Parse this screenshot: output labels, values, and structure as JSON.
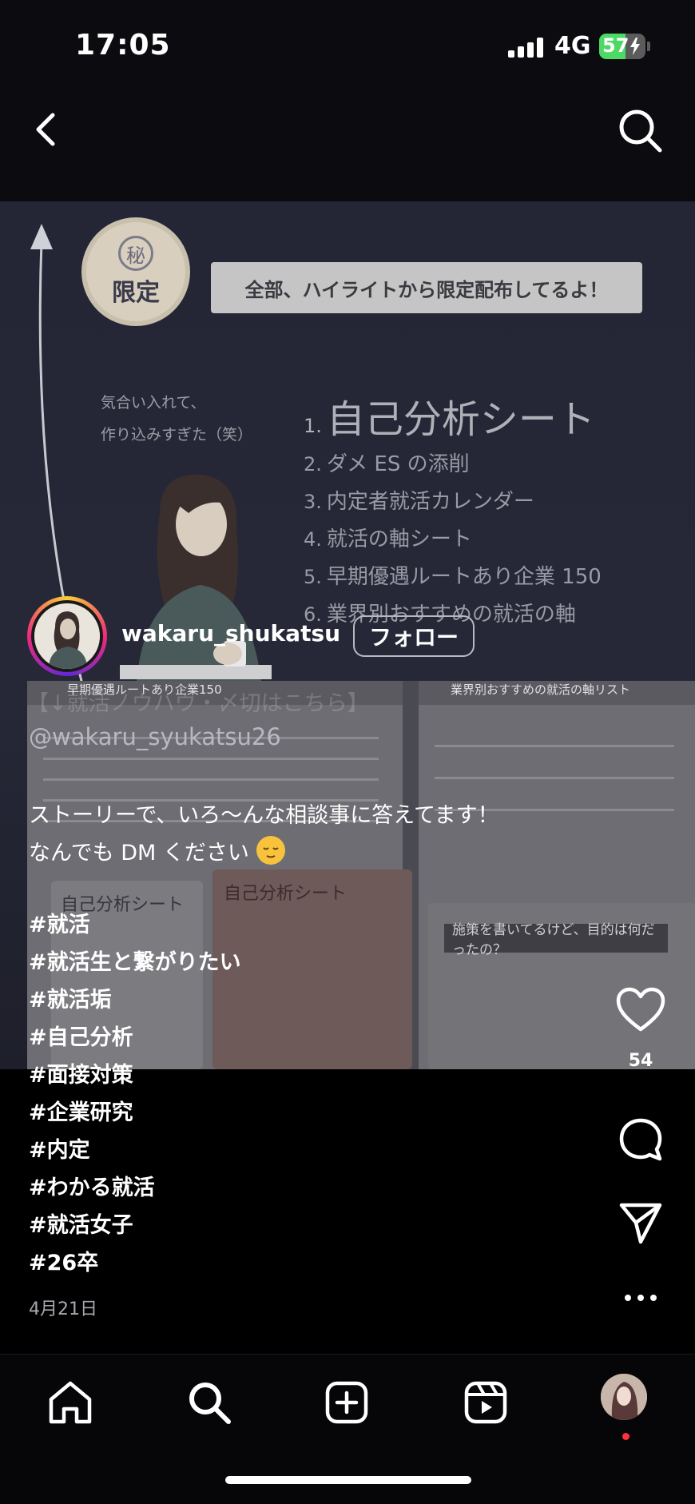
{
  "status_bar": {
    "time": "17:05",
    "network": "4G",
    "battery_percent": "57",
    "battery_level": 0.57,
    "charging": true,
    "signal_bars": 4
  },
  "top_nav": {
    "back_icon": "chevron-left-icon",
    "search_icon": "search-icon"
  },
  "media": {
    "badge_seal": "秘",
    "badge_text": "限定",
    "banner": "全部、ハイライトから限定配布してるよ！",
    "note": "気合い入れて、\n作り込みすぎた（笑）",
    "list": [
      {
        "num": "1.",
        "label": "自己分析シート"
      },
      {
        "num": "2.",
        "label": "ダメ ES の添削"
      },
      {
        "num": "3.",
        "label": "内定者就活カレンダー"
      },
      {
        "num": "4.",
        "label": "就活の軸シート"
      },
      {
        "num": "5.",
        "label": "早期優遇ルートあり企業 150"
      },
      {
        "num": "6.",
        "label": "業界別おすすめの就活の軸"
      }
    ],
    "ss_title": "施策を書いてるけど、目的は何だったの？",
    "ss_card_1": "自己分析シート",
    "ss_card_2": "自己分析シート",
    "ss_sheet_1": "早期優遇ルートあり企業150",
    "ss_sheet_2": "業界別おすすめの就活の軸リスト"
  },
  "post": {
    "username": "wakaru_shukatsu",
    "follow_label": "フォロー",
    "bio_ghost": "【↓就活ノウハウ・〆切はこちら】",
    "handle": "@wakaru_syukatsu26",
    "caption_line1": "ストーリーで、いろ〜んな相談事に答えてます！",
    "caption_line2": "なんでも DM ください",
    "hashtags": [
      "#就活",
      "#就活生と繋がりたい",
      "#就活垢",
      "#自己分析",
      "#面接対策",
      "#企業研究",
      "#内定",
      "#わかる就活",
      "#就活女子",
      "#26卒"
    ],
    "date": "4月21日"
  },
  "actions": {
    "like_count": "54",
    "like_icon": "heart-icon",
    "comment_icon": "comment-icon",
    "share_icon": "send-icon",
    "more_icon": "more-horizontal-icon"
  },
  "tab_bar": {
    "tabs": [
      "home-icon",
      "search-icon",
      "create-icon",
      "reels-icon",
      "profile-avatar"
    ]
  }
}
